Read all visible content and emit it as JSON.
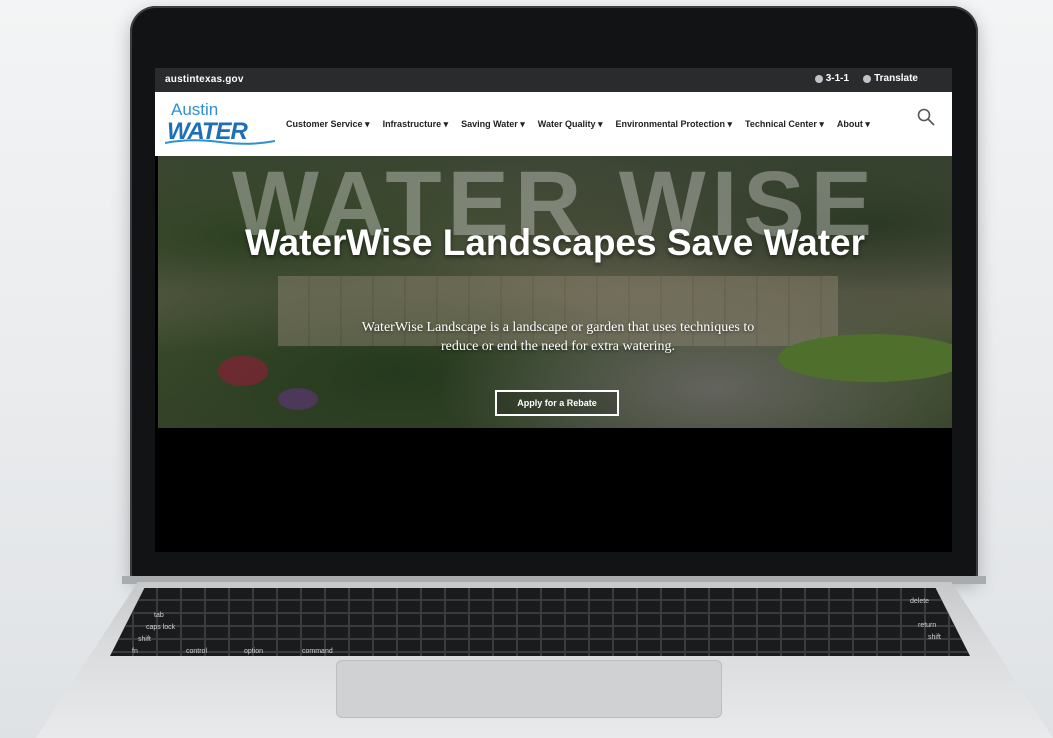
{
  "site": {
    "domain": "austintexas.gov",
    "utility": {
      "phone_label": "3-1-1",
      "translate_label": "Translate"
    }
  },
  "logo": {
    "line1": "Austin",
    "line2": "WATER"
  },
  "nav": {
    "items": [
      {
        "label": "Customer Service ▾"
      },
      {
        "label": "Infrastructure ▾"
      },
      {
        "label": "Saving Water ▾"
      },
      {
        "label": "Water Quality ▾"
      },
      {
        "label": "Environmental Protection ▾"
      },
      {
        "label": "Technical Center ▾"
      },
      {
        "label": "About ▾"
      }
    ],
    "search_icon": "search-icon"
  },
  "hero": {
    "background_word": "WATER WISE",
    "title": "WaterWise Landscapes Save Water",
    "subtitle": "WaterWise Landscape is a landscape or garden that uses techniques to reduce or end the need for extra watering.",
    "cta_label": "Apply for a Rebate"
  },
  "keyboard": {
    "labels": [
      "tab",
      "caps lock",
      "shift",
      "control",
      "option",
      "command",
      "delete",
      "return",
      "shift",
      "fn"
    ]
  },
  "colors": {
    "topbar": "#2a2b2d",
    "brand_blue": "#1e6fb8",
    "logo_light_blue": "#2f8fd0"
  }
}
